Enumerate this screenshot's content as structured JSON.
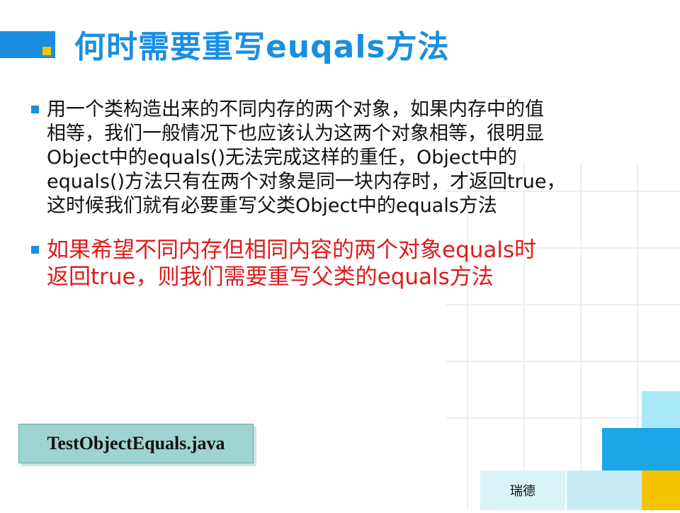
{
  "slide": {
    "title": "何时需要重写euqals方法",
    "bullets": [
      {
        "text": "用一个类构造出来的不同内存的两个对象，如果内存中的值\n相等，我们一般情况下也应该认为这两个对象相等，很明显\nObject中的equals()无法完成这样的重任，Object中的\nequals()方法只有在两个对象是同一块内存时，才返回true，\n这时候我们就有必要重写父类Object中的equals方法",
        "color": "#111111"
      },
      {
        "text": "如果希望不同内存但相同内容的两个对象equals时\n返回true，则我们需要重写父类的equals方法",
        "color": "#e01b1b"
      }
    ],
    "file_label": "TestObjectEquals.java",
    "footer": "瑞德"
  },
  "colors": {
    "accent": "#1a8fe0",
    "highlight": "#f5c400",
    "emphasis": "#e01b1b",
    "file_box": "#9fd3cf"
  }
}
